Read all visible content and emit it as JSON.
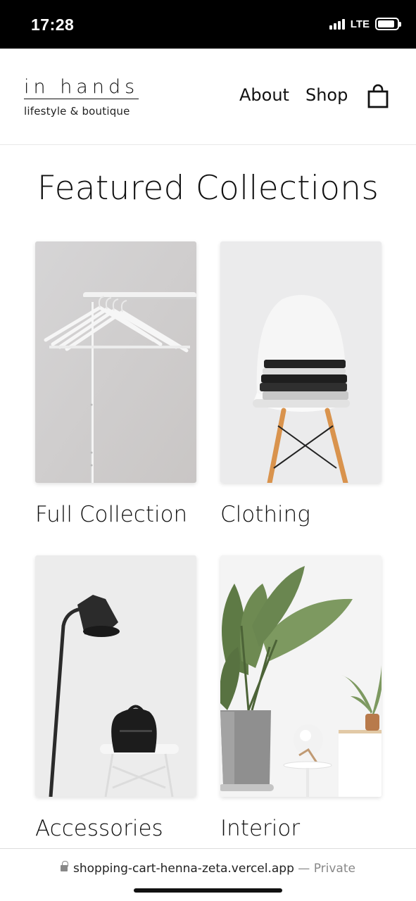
{
  "status_bar": {
    "time": "17:28",
    "network": "LTE",
    "battery_level": 0.9
  },
  "header": {
    "brand_name": "in hands",
    "brand_tagline": "lifestyle & boutique",
    "nav": {
      "about": "About",
      "shop": "Shop"
    },
    "cart_icon": "shopping-bag-icon"
  },
  "main": {
    "title": "Featured Collections",
    "collections": [
      {
        "label": "Full Collection",
        "image": "clothes-rack-photo"
      },
      {
        "label": "Clothing",
        "image": "chair-with-folded-clothes-photo"
      },
      {
        "label": "Accessories",
        "image": "lamp-and-backpack-photo"
      },
      {
        "label": "Interior",
        "image": "potted-plants-photo"
      }
    ]
  },
  "browser": {
    "url": "shopping-cart-henna-zeta.vercel.app",
    "separator": "—",
    "mode": "Private"
  }
}
